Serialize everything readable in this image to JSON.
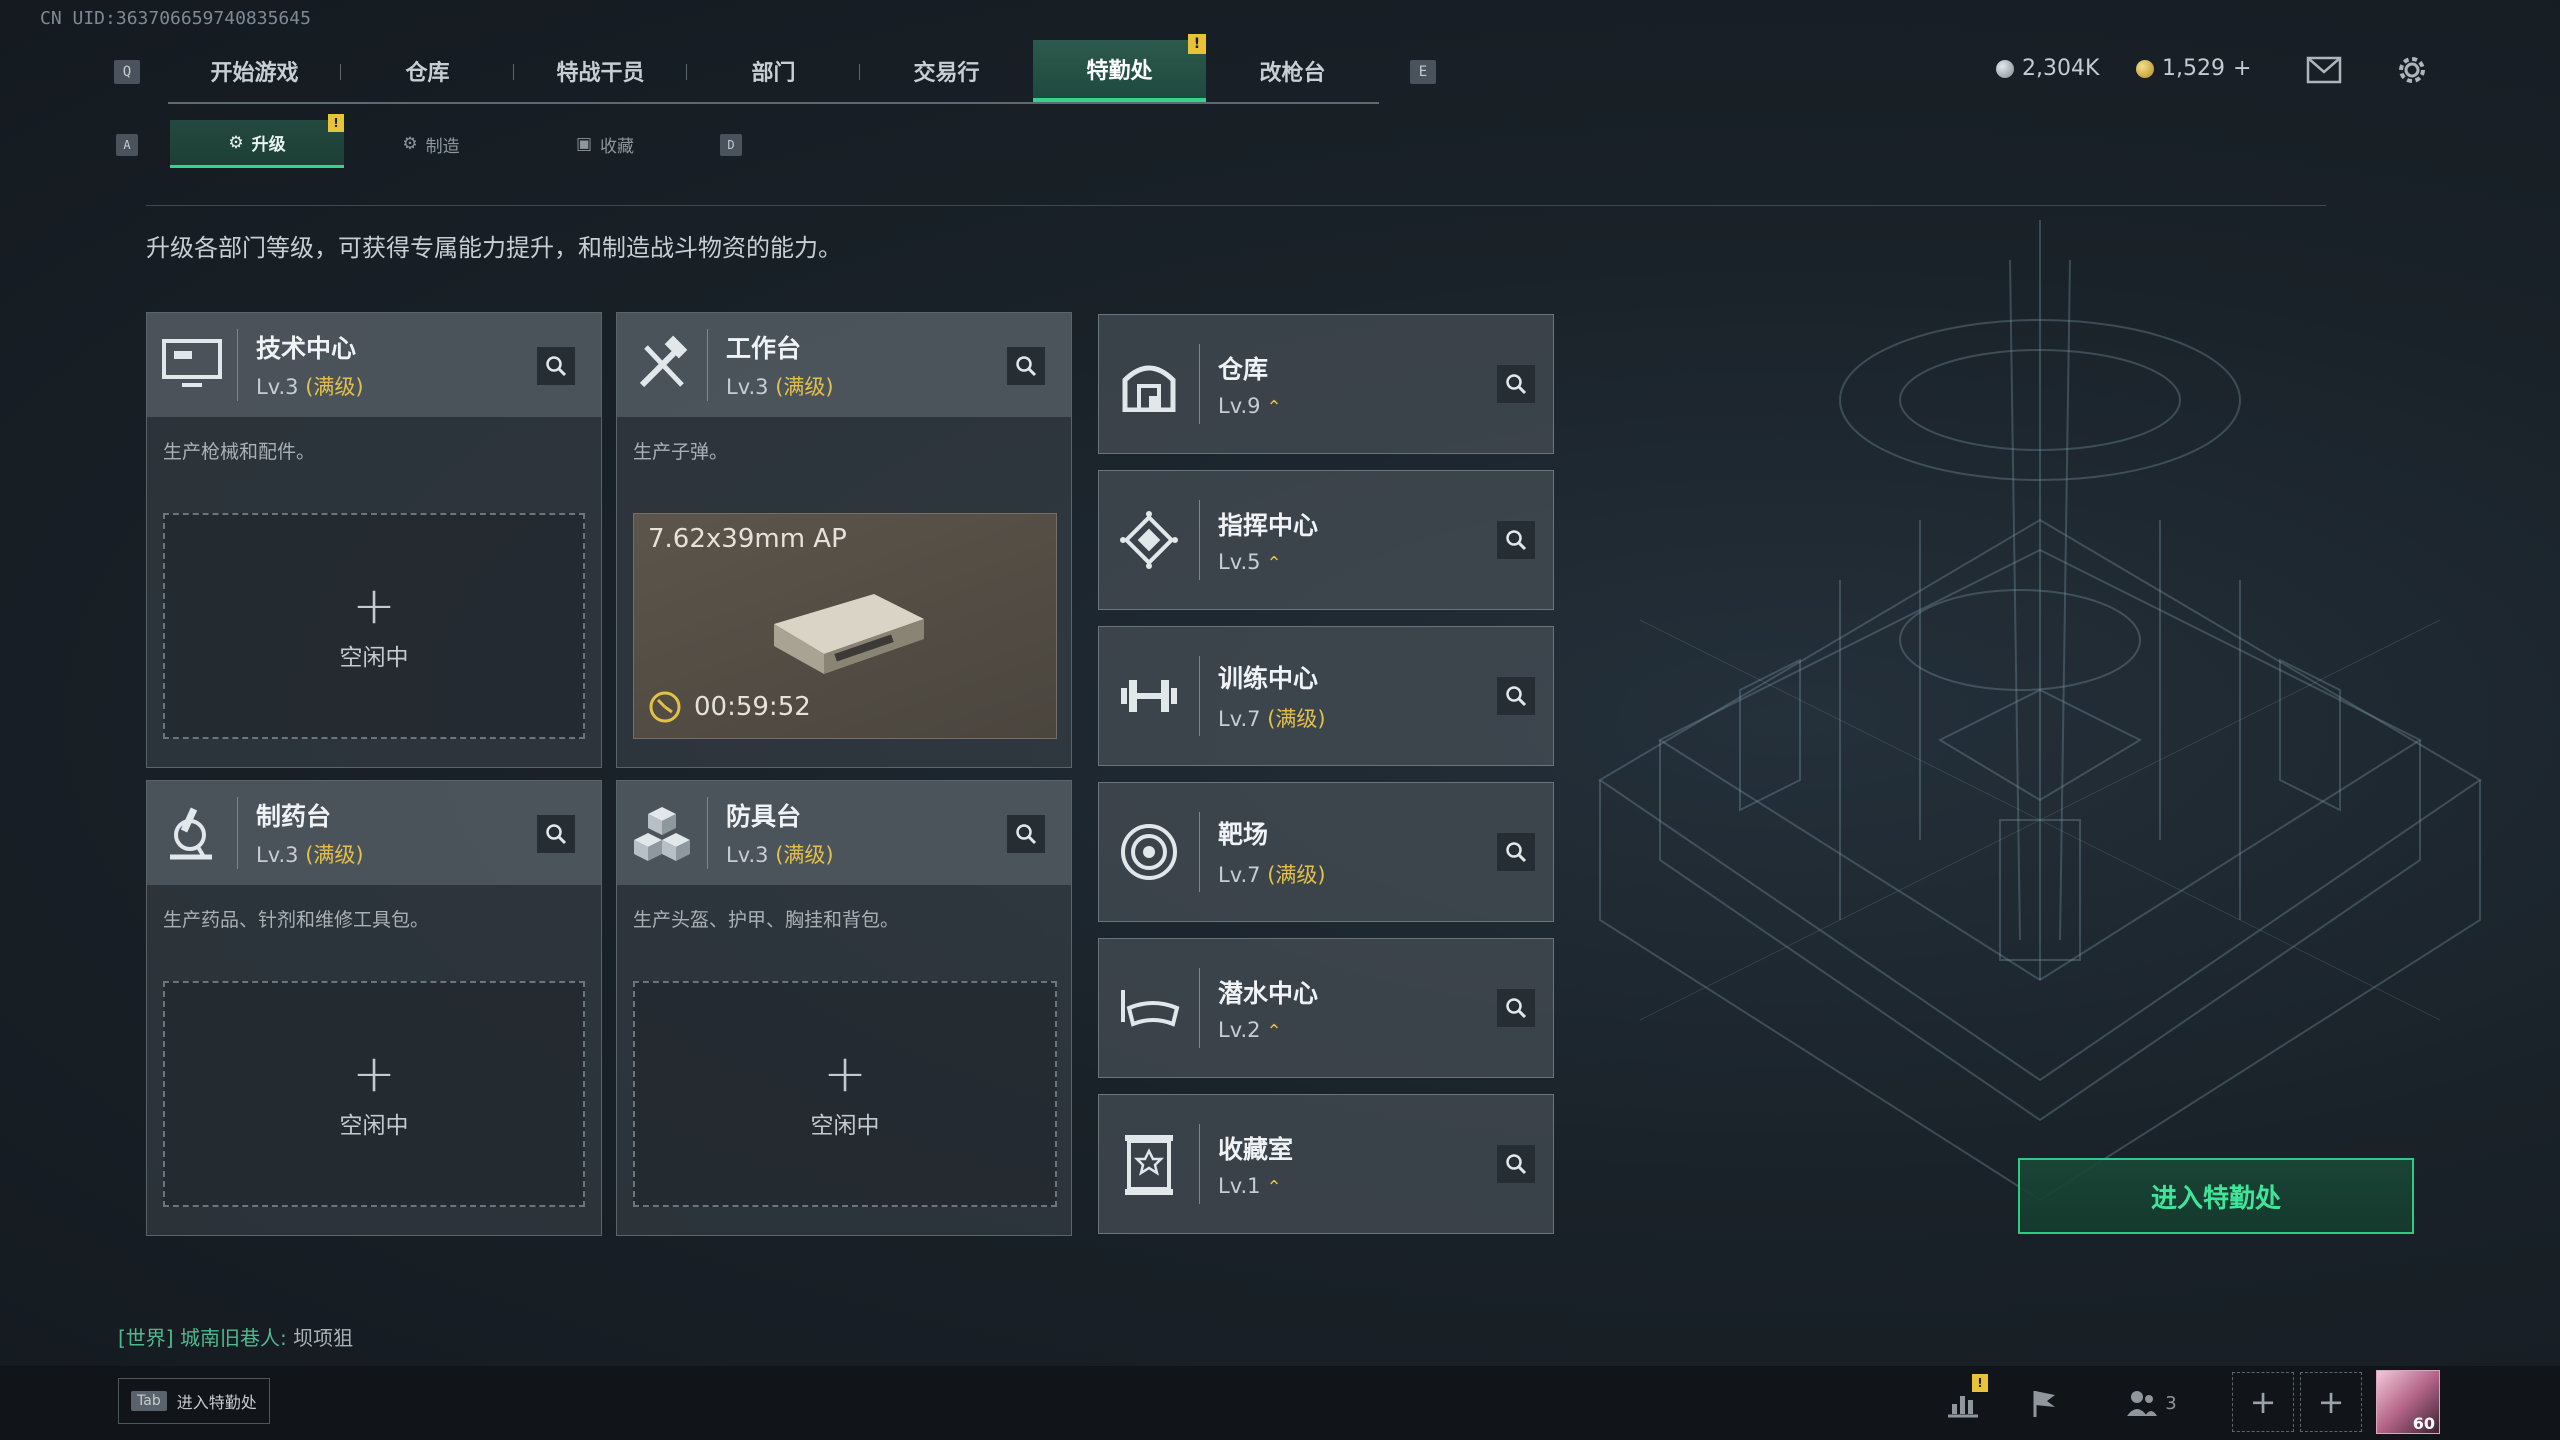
{
  "uid": "CN UID:363706659740835645",
  "key_hints": {
    "left_tab": "Q",
    "right_tab": "E",
    "left_sub": "A",
    "right_sub": "D"
  },
  "nav": {
    "tabs": [
      {
        "label": "开始游戏"
      },
      {
        "label": "仓库"
      },
      {
        "label": "特战干员"
      },
      {
        "label": "部门"
      },
      {
        "label": "交易行"
      },
      {
        "label": "特勤处",
        "active": true,
        "badge": "!"
      },
      {
        "label": "改枪台"
      }
    ]
  },
  "currency": {
    "silver": "2,304K",
    "gold": "1,529",
    "gold_plus": "+"
  },
  "icons": {
    "mail": "mail-icon",
    "settings": "gear-icon"
  },
  "subnav": {
    "tabs": [
      {
        "label": "升级",
        "active": true,
        "badge": "!"
      },
      {
        "label": "制造"
      },
      {
        "label": "收藏"
      }
    ]
  },
  "description": "升级各部门等级，可获得专属能力提升，和制造战斗物资的能力。",
  "facilities": [
    {
      "name": "技术中心",
      "level": "Lv.3",
      "max": "(满级)",
      "desc": "生产枪械和配件。",
      "slot": {
        "plus": "+",
        "status": "空闲中"
      }
    },
    {
      "name": "工作台",
      "level": "Lv.3",
      "max": "(满级)",
      "desc": "生产子弹。",
      "production": {
        "item": "7.62x39mm AP",
        "timer": "00:59:52"
      }
    },
    {
      "name": "制药台",
      "level": "Lv.3",
      "max": "(满级)",
      "desc": "生产药品、针剂和维修工具包。",
      "slot": {
        "plus": "+",
        "status": "空闲中"
      }
    },
    {
      "name": "防具台",
      "level": "Lv.3",
      "max": "(满级)",
      "desc": "生产头盔、护甲、胸挂和背包。",
      "slot": {
        "plus": "+",
        "status": "空闲中"
      }
    }
  ],
  "departments": [
    {
      "name": "仓库",
      "level": "Lv.9",
      "max": "",
      "upgradable": true,
      "icon": "warehouse-icon"
    },
    {
      "name": "指挥中心",
      "level": "Lv.5",
      "max": "",
      "upgradable": true,
      "icon": "command-icon"
    },
    {
      "name": "训练中心",
      "level": "Lv.7",
      "max": "(满级)",
      "upgradable": false,
      "icon": "dumbbell-icon"
    },
    {
      "name": "靶场",
      "level": "Lv.7",
      "max": "(满级)",
      "upgradable": false,
      "icon": "target-icon"
    },
    {
      "name": "潜水中心",
      "level": "Lv.2",
      "max": "",
      "upgradable": true,
      "icon": "diving-mask-icon"
    },
    {
      "name": "收藏室",
      "level": "Lv.1",
      "max": "",
      "upgradable": true,
      "icon": "trophy-icon"
    }
  ],
  "up_glyph": "⌃",
  "enter_button": "进入特勤处",
  "chat": {
    "channel": "[世界]",
    "sender": "城南旧巷人:",
    "message": "坝项狙"
  },
  "bottom": {
    "tab_key": "Tab",
    "tab_label": "进入特勤处",
    "friends_count": "3",
    "badge": "!",
    "avatar_level": "60"
  },
  "colors": {
    "accent": "#36d48b",
    "gold": "#e3c04a",
    "badge": "#e8c33a"
  }
}
